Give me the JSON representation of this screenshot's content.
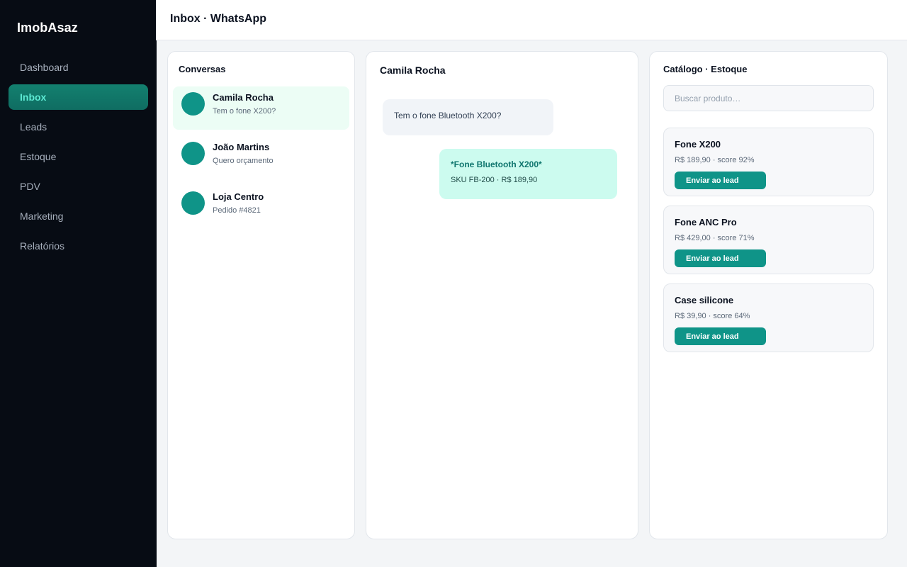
{
  "app": {
    "brand": "ImobAsaz"
  },
  "sidebar": {
    "items": [
      {
        "label": "Dashboard",
        "active": false
      },
      {
        "label": "Inbox",
        "active": true
      },
      {
        "label": "Leads",
        "active": false
      },
      {
        "label": "Estoque",
        "active": false
      },
      {
        "label": "PDV",
        "active": false
      },
      {
        "label": "Marketing",
        "active": false
      },
      {
        "label": "Relatórios",
        "active": false
      }
    ]
  },
  "header": {
    "title": "Inbox · WhatsApp"
  },
  "conversations": {
    "title": "Conversas",
    "items": [
      {
        "name": "Camila Rocha",
        "preview": "Tem o fone X200?",
        "active": true
      },
      {
        "name": "João Martins",
        "preview": "Quero orçamento",
        "active": false
      },
      {
        "name": "Loja Centro",
        "preview": "Pedido #4821",
        "active": false
      }
    ]
  },
  "chat": {
    "contact": "Camila Rocha",
    "incoming": {
      "text": "Tem o fone Bluetooth X200?"
    },
    "outgoing": {
      "title": "*Fone Bluetooth X200*",
      "subtitle": "SKU FB-200 · R$ 189,90"
    }
  },
  "catalog": {
    "title": "Catálogo · Estoque",
    "search_placeholder": "Buscar produto…",
    "products": [
      {
        "name": "Fone X200",
        "meta": "R$ 189,90 · score 92%",
        "button": "Enviar ao lead"
      },
      {
        "name": "Fone ANC Pro",
        "meta": "R$ 429,00 · score 71%",
        "button": "Enviar ao lead"
      },
      {
        "name": "Case silicone",
        "meta": "R$ 39,90 · score 64%",
        "button": "Enviar ao lead"
      }
    ]
  },
  "colors": {
    "sidebar_bg": "#070c14",
    "accent": "#0f9488",
    "active_nav_text": "#5eead4",
    "active_conv_bg": "#ecfdf5",
    "outgoing_bubble": "#ccfbef"
  }
}
